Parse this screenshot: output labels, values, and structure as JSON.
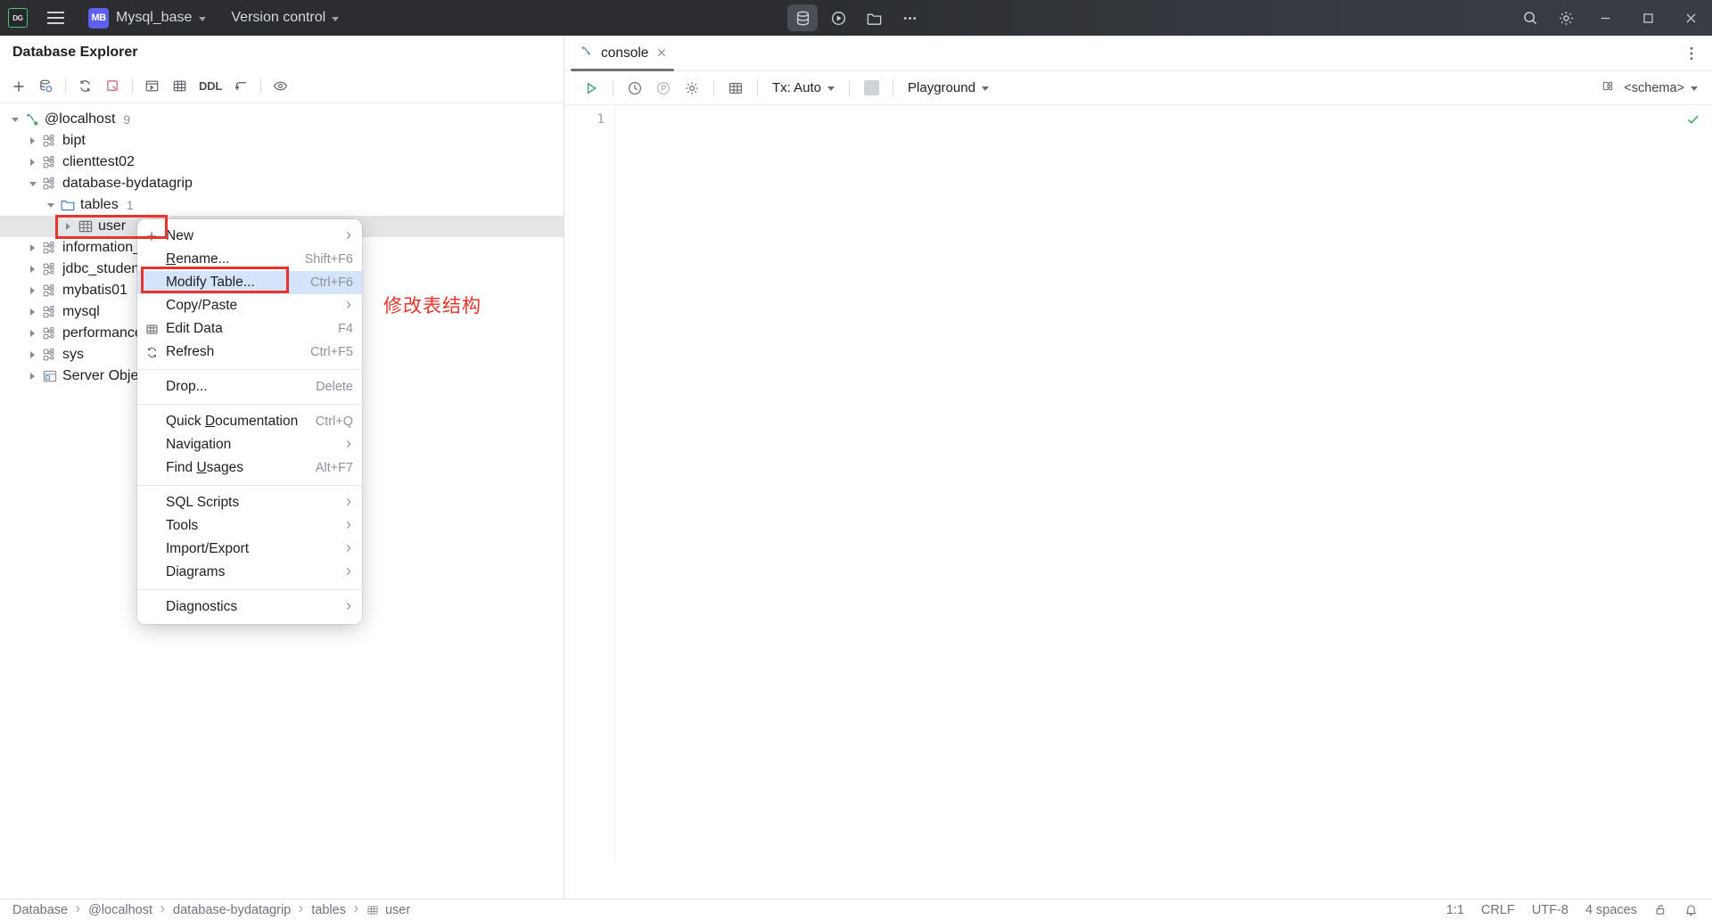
{
  "titlebar": {
    "logo_text": "DG",
    "logo_icon": "datagrip-logo-icon",
    "menu_icon": "hamburger-menu-icon",
    "project_badge": "MB",
    "project_name": "Mysql_base",
    "vcs_label": "Version control",
    "center_buttons": [
      {
        "name": "database-icon",
        "glyph": "db"
      },
      {
        "name": "run-icon",
        "glyph": "run"
      },
      {
        "name": "folder-icon",
        "glyph": "folder"
      },
      {
        "name": "more-icon",
        "glyph": "more"
      }
    ],
    "right_buttons": [
      {
        "name": "search-icon",
        "glyph": "search"
      },
      {
        "name": "settings-icon",
        "glyph": "gear"
      }
    ],
    "window_buttons": [
      {
        "name": "minimize-button",
        "glyph": "minimize"
      },
      {
        "name": "maximize-button",
        "glyph": "maximize"
      },
      {
        "name": "close-button",
        "glyph": "close"
      }
    ]
  },
  "explorer": {
    "title": "Database Explorer",
    "toolbar": [
      {
        "name": "add-datasource-button",
        "glyph": "plus"
      },
      {
        "name": "sync-datasource-button",
        "glyph": "db-sync"
      },
      {
        "name": "refresh-button",
        "glyph": "refresh"
      },
      {
        "name": "stop-refresh-button",
        "glyph": "stop-refresh"
      },
      {
        "name": "open-console-button",
        "glyph": "console"
      },
      {
        "name": "edit-data-button",
        "glyph": "table"
      },
      {
        "name": "ddl-button",
        "glyph": "ddl",
        "label": "DDL"
      },
      {
        "name": "jump-to-editor-button",
        "glyph": "jump"
      },
      {
        "name": "preview-button",
        "glyph": "eye"
      }
    ],
    "tree": [
      {
        "name": "tree-item-localhost",
        "label": "@localhost",
        "count": "9",
        "indent": 0,
        "twisty": "down",
        "icon": "connection-icon"
      },
      {
        "name": "tree-item-bipt",
        "label": "bipt",
        "count": "",
        "indent": 1,
        "twisty": "right",
        "icon": "schema-icon"
      },
      {
        "name": "tree-item-clienttest02",
        "label": "clienttest02",
        "count": "",
        "indent": 1,
        "twisty": "right",
        "icon": "schema-icon"
      },
      {
        "name": "tree-item-database-bydatagrip",
        "label": "database-bydatagrip",
        "count": "",
        "indent": 1,
        "twisty": "down",
        "icon": "schema-icon"
      },
      {
        "name": "tree-item-tables",
        "label": "tables",
        "count": "1",
        "indent": 2,
        "twisty": "down",
        "icon": "folder-icon"
      },
      {
        "name": "tree-item-user",
        "label": "user",
        "count": "",
        "indent": 3,
        "twisty": "right",
        "icon": "table-icon",
        "selected": true
      },
      {
        "name": "tree-item-information-schema",
        "label": "information_s",
        "count": "",
        "indent": 1,
        "twisty": "right",
        "icon": "schema-icon"
      },
      {
        "name": "tree-item-jdbc-student",
        "label": "jdbc_student",
        "count": "",
        "indent": 1,
        "twisty": "right",
        "icon": "schema-icon"
      },
      {
        "name": "tree-item-mybatis01",
        "label": "mybatis01",
        "count": "",
        "indent": 1,
        "twisty": "right",
        "icon": "schema-icon"
      },
      {
        "name": "tree-item-mysql",
        "label": "mysql",
        "count": "",
        "indent": 1,
        "twisty": "right",
        "icon": "schema-icon"
      },
      {
        "name": "tree-item-performance-schema",
        "label": "performance_",
        "count": "",
        "indent": 1,
        "twisty": "right",
        "icon": "schema-icon"
      },
      {
        "name": "tree-item-sys",
        "label": "sys",
        "count": "",
        "indent": 1,
        "twisty": "right",
        "icon": "schema-icon"
      },
      {
        "name": "tree-item-server-objects",
        "label": "Server Object",
        "count": "",
        "indent": 1,
        "twisty": "right",
        "icon": "server-objects-icon"
      }
    ]
  },
  "context_menu": [
    {
      "name": "menu-item-new",
      "label": "New",
      "shortcut": "",
      "icon": "plus-icon",
      "submenu": true
    },
    {
      "name": "menu-item-rename",
      "label": "Rename...",
      "underline": "R",
      "shortcut": "Shift+F6",
      "icon": "",
      "submenu": false
    },
    {
      "name": "menu-item-modify-table",
      "label": "Modify Table...",
      "shortcut": "Ctrl+F6",
      "icon": "",
      "submenu": false,
      "highlighted": true
    },
    {
      "name": "menu-item-copy-paste",
      "label": "Copy/Paste",
      "shortcut": "",
      "icon": "",
      "submenu": true
    },
    {
      "name": "menu-item-edit-data",
      "label": "Edit Data",
      "shortcut": "F4",
      "icon": "table-icon",
      "submenu": false
    },
    {
      "name": "menu-item-refresh",
      "label": "Refresh",
      "shortcut": "Ctrl+F5",
      "icon": "refresh-icon",
      "submenu": false
    },
    {
      "separator": true
    },
    {
      "name": "menu-item-drop",
      "label": "Drop...",
      "shortcut": "Delete",
      "icon": "",
      "submenu": false
    },
    {
      "separator": true
    },
    {
      "name": "menu-item-quick-documentation",
      "label": "Quick Documentation",
      "underline": "D",
      "shortcut": "Ctrl+Q",
      "icon": "",
      "submenu": false
    },
    {
      "name": "menu-item-navigation",
      "label": "Navigation",
      "shortcut": "",
      "icon": "",
      "submenu": true
    },
    {
      "name": "menu-item-find-usages",
      "label": "Find Usages",
      "underline": "U",
      "shortcut": "Alt+F7",
      "icon": "",
      "submenu": false
    },
    {
      "separator": true
    },
    {
      "name": "menu-item-sql-scripts",
      "label": "SQL Scripts",
      "shortcut": "",
      "icon": "",
      "submenu": true
    },
    {
      "name": "menu-item-tools",
      "label": "Tools",
      "shortcut": "",
      "icon": "",
      "submenu": true
    },
    {
      "name": "menu-item-import-export",
      "label": "Import/Export",
      "shortcut": "",
      "icon": "",
      "submenu": true
    },
    {
      "name": "menu-item-diagrams",
      "label": "Diagrams",
      "shortcut": "",
      "icon": "",
      "submenu": true
    },
    {
      "separator": true
    },
    {
      "name": "menu-item-diagnostics",
      "label": "Diagnostics",
      "shortcut": "",
      "icon": "",
      "submenu": true
    }
  ],
  "annotation": {
    "text": "修改表结构",
    "color": "#e8342a"
  },
  "editor": {
    "tab_label": "console",
    "tab_icon": "console-icon",
    "tab_close_icon": "close-icon",
    "toolbar": {
      "run_icon": "run-triangle-icon",
      "history_icon": "clock-icon",
      "params_icon": "parameters-icon",
      "settings_icon": "gear-icon",
      "table_icon": "table-grid-icon",
      "tx_label": "Tx: Auto",
      "stop_icon": "stop-square-icon",
      "schema_selector": "Playground",
      "schema_right": "<schema>",
      "schema_right_icon": "schema-picker-icon"
    },
    "line_numbers": [
      "1"
    ],
    "code": [
      ""
    ],
    "inspection_status": "ok-check-icon"
  },
  "statusbar": {
    "breadcrumbs": [
      "Database",
      "@localhost",
      "database-bydatagrip",
      "tables",
      "user"
    ],
    "breadcrumb_last_icon": "table-icon",
    "caret_position": "1:1",
    "line_separator": "CRLF",
    "encoding": "UTF-8",
    "indent": "4 spaces",
    "lock_icon": "unlocked-icon",
    "notification_icon": "bell-icon"
  }
}
